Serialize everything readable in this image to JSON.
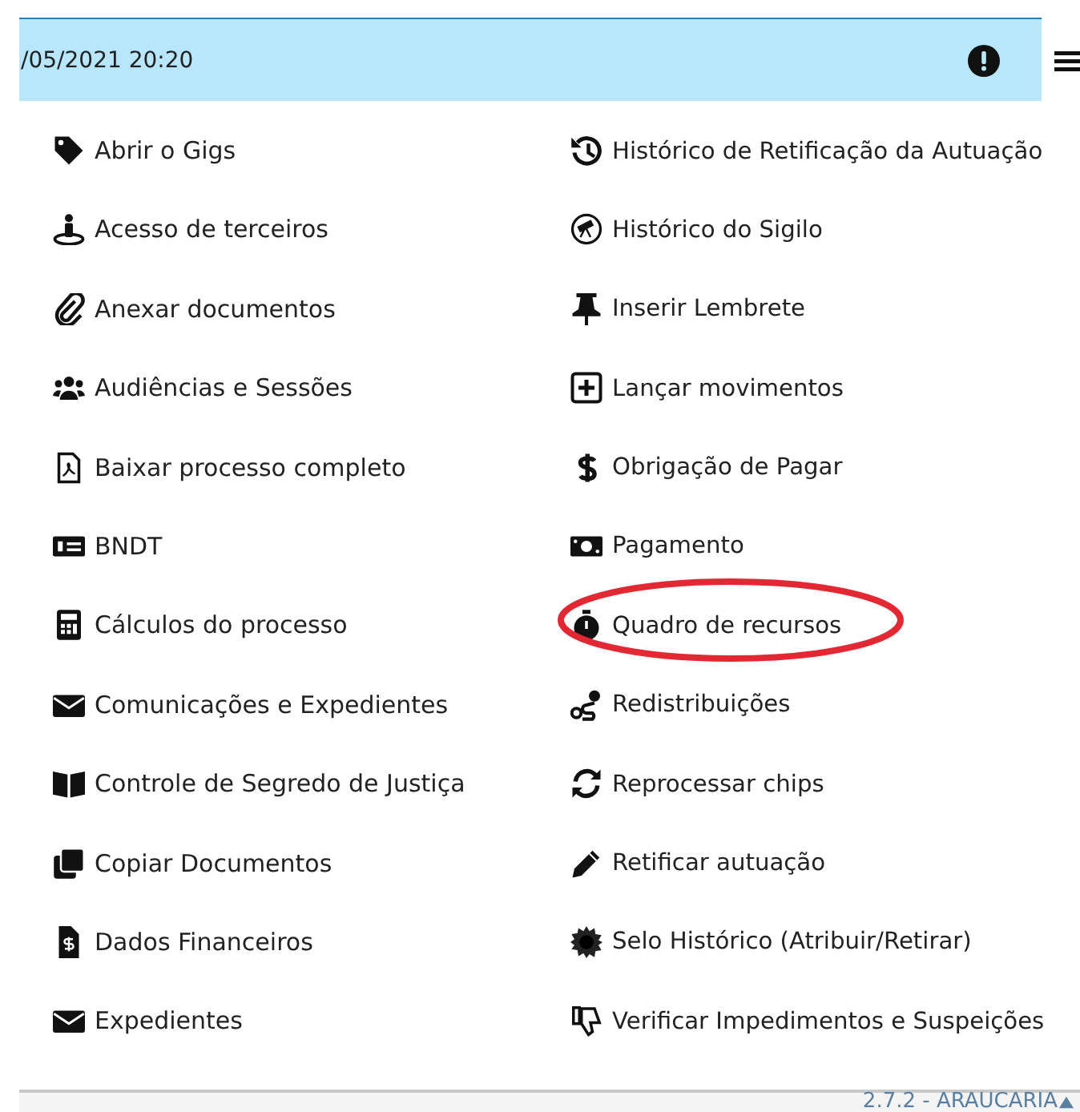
{
  "header": {
    "datetime": "/05/2021 20:20"
  },
  "menu": {
    "columns": [
      [
        {
          "label": "Abrir o Gigs",
          "highlighted": false
        },
        {
          "label": "Acesso de terceiros",
          "highlighted": false
        },
        {
          "label": "Anexar documentos",
          "highlighted": false
        },
        {
          "label": "Audiências e Sessões",
          "highlighted": false
        },
        {
          "label": "Baixar processo completo",
          "highlighted": false
        },
        {
          "label": "BNDT",
          "highlighted": false
        },
        {
          "label": "Cálculos do processo",
          "highlighted": false
        },
        {
          "label": "Comunicações e Expedientes",
          "highlighted": false
        },
        {
          "label": "Controle de Segredo de Justiça",
          "highlighted": false
        },
        {
          "label": "Copiar Documentos",
          "highlighted": false
        },
        {
          "label": "Dados Financeiros",
          "highlighted": false
        },
        {
          "label": "Expedientes",
          "highlighted": false
        }
      ],
      [
        {
          "label": "Histórico de Retificação da Autuação",
          "highlighted": false
        },
        {
          "label": "Histórico do Sigilo",
          "highlighted": false
        },
        {
          "label": "Inserir Lembrete",
          "highlighted": false
        },
        {
          "label": "Lançar movimentos",
          "highlighted": false
        },
        {
          "label": "Obrigação de Pagar",
          "highlighted": false
        },
        {
          "label": "Pagamento",
          "highlighted": false
        },
        {
          "label": "Quadro de recursos",
          "highlighted": true
        },
        {
          "label": "Redistribuições",
          "highlighted": false
        },
        {
          "label": "Reprocessar chips",
          "highlighted": false
        },
        {
          "label": "Retificar autuação",
          "highlighted": false
        },
        {
          "label": "Selo Histórico (Atribuir/Retirar)",
          "highlighted": false
        },
        {
          "label": "Verificar Impedimentos e Suspeições",
          "highlighted": false
        }
      ]
    ]
  },
  "footer": {
    "version": "2.7.2 - ARAUCARIA"
  }
}
